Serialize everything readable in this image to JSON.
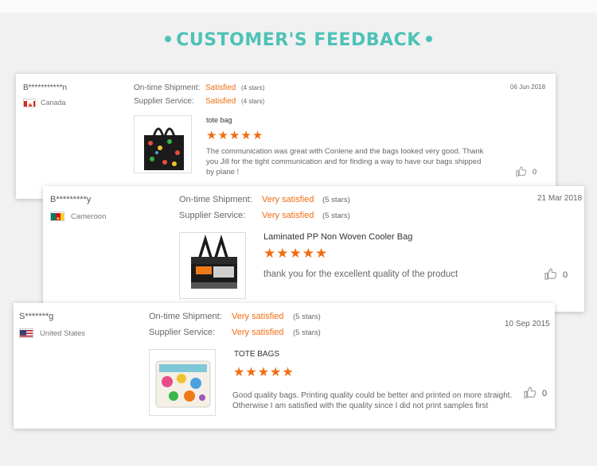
{
  "heading": "CUSTOMER'S FEEDBACK",
  "labels": {
    "shipment": "On-time Shipment:",
    "service": "Supplier Service:"
  },
  "reviews": [
    {
      "name": "B***********n",
      "country": "Canada",
      "date": "06 Jun 2018",
      "shipment_rating": "Satisfied",
      "shipment_stars": "(4 stars)",
      "service_rating": "Satisfied",
      "service_stars": "(4 stars)",
      "product": "tote bag",
      "stars": 5,
      "comment": "The communication was great with Conlene and the bags looked very good. Thank you Jill for the tight communication and for finding a way to have our bags shipped by plane !",
      "likes": "0"
    },
    {
      "name": "B*********y",
      "country": "Cameroon",
      "date": "21 Mar 2018",
      "shipment_rating": "Very satisfied",
      "shipment_stars": "(5 stars)",
      "service_rating": "Very satisfied",
      "service_stars": "(5 stars)",
      "product": "Laminated PP Non Woven Cooler Bag",
      "stars": 5,
      "comment": "thank you for the excellent quality of the product",
      "likes": "0"
    },
    {
      "name": "S*******g",
      "country": "United States",
      "date": "10 Sep 2015",
      "shipment_rating": "Very satisfied",
      "shipment_stars": "(5 stars)",
      "service_rating": "Very satisfied",
      "service_stars": "(5 stars)",
      "product": "TOTE BAGS",
      "stars": 5,
      "comment": "Good quality bags. Printing quality could be better and printed on more straight. Otherwise I am satisfied with the quality since I did not print samples first",
      "likes": "0"
    }
  ],
  "colors": {
    "accent": "#4ec2b6",
    "rating": "#f06d14"
  }
}
